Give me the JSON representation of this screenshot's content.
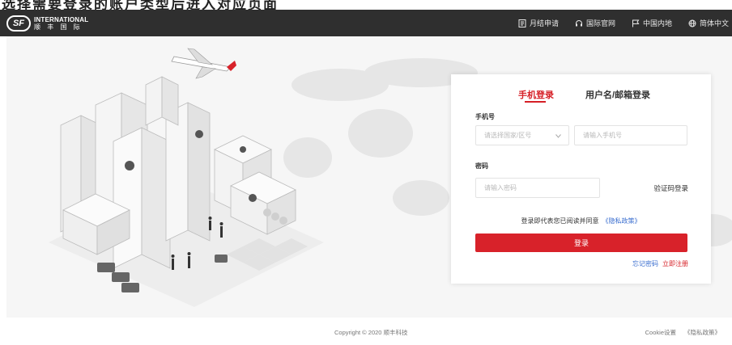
{
  "top_strip": {
    "text": "选择需要登录的账户类型后进入对应页面"
  },
  "brand": {
    "mark": "SF",
    "name_line1": "INTERNATIONAL",
    "name_line2": "顺 丰 国 际"
  },
  "nav": {
    "items": [
      {
        "icon": "document-icon",
        "label": "月结申请"
      },
      {
        "icon": "headset-icon",
        "label": "国际官网"
      },
      {
        "icon": "flag-icon",
        "label": "中国内地"
      },
      {
        "icon": "globe-icon",
        "label": "简体中文"
      }
    ]
  },
  "login": {
    "tabs": {
      "active": "手机登录",
      "other": "用户名/邮箱登录"
    },
    "phone_label": "手机号",
    "country_placeholder": "请选择国家/区号",
    "phone_placeholder": "请输入手机号",
    "password_label": "密码",
    "password_placeholder": "请输入密码",
    "code_login": "验证码登录",
    "agreement_text": "登录即代表您已阅读并同意",
    "privacy_link": "《隐私政策》",
    "submit": "登录",
    "forgot": "忘记密码",
    "register": "立即注册"
  },
  "footer": {
    "copyright": "Copyright © 2020 顺丰科技",
    "cookie": "Cookie设置",
    "privacy": "《隐私政策》"
  },
  "colors": {
    "header_bg": "#2f2f2f",
    "accent_red": "#d8222a",
    "link_blue": "#3a6ecf",
    "hero_bg": "#f6f6f6"
  }
}
